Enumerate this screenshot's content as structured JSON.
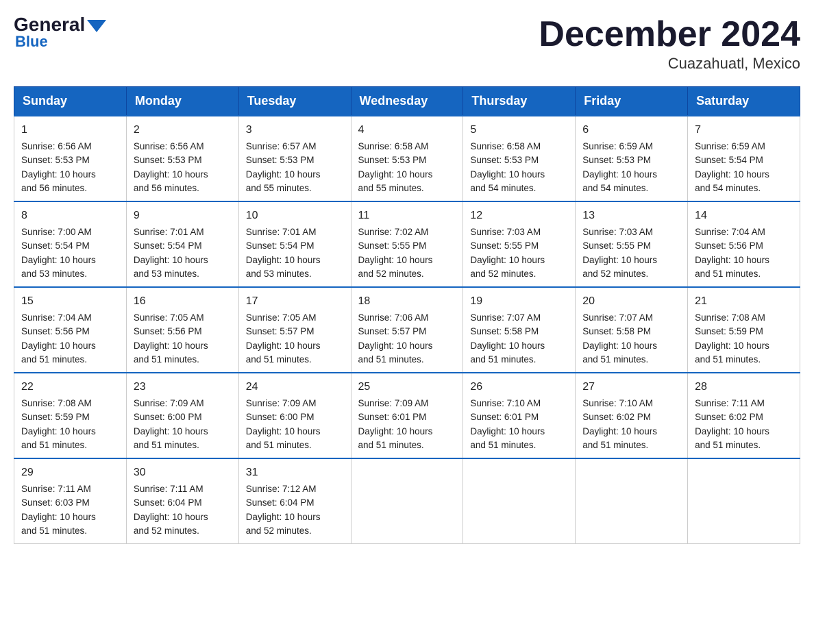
{
  "logo": {
    "general": "General",
    "blue": "Blue"
  },
  "title": "December 2024",
  "location": "Cuazahuatl, Mexico",
  "days_header": [
    "Sunday",
    "Monday",
    "Tuesday",
    "Wednesday",
    "Thursday",
    "Friday",
    "Saturday"
  ],
  "weeks": [
    [
      {
        "day": "1",
        "info": "Sunrise: 6:56 AM\nSunset: 5:53 PM\nDaylight: 10 hours\nand 56 minutes."
      },
      {
        "day": "2",
        "info": "Sunrise: 6:56 AM\nSunset: 5:53 PM\nDaylight: 10 hours\nand 56 minutes."
      },
      {
        "day": "3",
        "info": "Sunrise: 6:57 AM\nSunset: 5:53 PM\nDaylight: 10 hours\nand 55 minutes."
      },
      {
        "day": "4",
        "info": "Sunrise: 6:58 AM\nSunset: 5:53 PM\nDaylight: 10 hours\nand 55 minutes."
      },
      {
        "day": "5",
        "info": "Sunrise: 6:58 AM\nSunset: 5:53 PM\nDaylight: 10 hours\nand 54 minutes."
      },
      {
        "day": "6",
        "info": "Sunrise: 6:59 AM\nSunset: 5:53 PM\nDaylight: 10 hours\nand 54 minutes."
      },
      {
        "day": "7",
        "info": "Sunrise: 6:59 AM\nSunset: 5:54 PM\nDaylight: 10 hours\nand 54 minutes."
      }
    ],
    [
      {
        "day": "8",
        "info": "Sunrise: 7:00 AM\nSunset: 5:54 PM\nDaylight: 10 hours\nand 53 minutes."
      },
      {
        "day": "9",
        "info": "Sunrise: 7:01 AM\nSunset: 5:54 PM\nDaylight: 10 hours\nand 53 minutes."
      },
      {
        "day": "10",
        "info": "Sunrise: 7:01 AM\nSunset: 5:54 PM\nDaylight: 10 hours\nand 53 minutes."
      },
      {
        "day": "11",
        "info": "Sunrise: 7:02 AM\nSunset: 5:55 PM\nDaylight: 10 hours\nand 52 minutes."
      },
      {
        "day": "12",
        "info": "Sunrise: 7:03 AM\nSunset: 5:55 PM\nDaylight: 10 hours\nand 52 minutes."
      },
      {
        "day": "13",
        "info": "Sunrise: 7:03 AM\nSunset: 5:55 PM\nDaylight: 10 hours\nand 52 minutes."
      },
      {
        "day": "14",
        "info": "Sunrise: 7:04 AM\nSunset: 5:56 PM\nDaylight: 10 hours\nand 51 minutes."
      }
    ],
    [
      {
        "day": "15",
        "info": "Sunrise: 7:04 AM\nSunset: 5:56 PM\nDaylight: 10 hours\nand 51 minutes."
      },
      {
        "day": "16",
        "info": "Sunrise: 7:05 AM\nSunset: 5:56 PM\nDaylight: 10 hours\nand 51 minutes."
      },
      {
        "day": "17",
        "info": "Sunrise: 7:05 AM\nSunset: 5:57 PM\nDaylight: 10 hours\nand 51 minutes."
      },
      {
        "day": "18",
        "info": "Sunrise: 7:06 AM\nSunset: 5:57 PM\nDaylight: 10 hours\nand 51 minutes."
      },
      {
        "day": "19",
        "info": "Sunrise: 7:07 AM\nSunset: 5:58 PM\nDaylight: 10 hours\nand 51 minutes."
      },
      {
        "day": "20",
        "info": "Sunrise: 7:07 AM\nSunset: 5:58 PM\nDaylight: 10 hours\nand 51 minutes."
      },
      {
        "day": "21",
        "info": "Sunrise: 7:08 AM\nSunset: 5:59 PM\nDaylight: 10 hours\nand 51 minutes."
      }
    ],
    [
      {
        "day": "22",
        "info": "Sunrise: 7:08 AM\nSunset: 5:59 PM\nDaylight: 10 hours\nand 51 minutes."
      },
      {
        "day": "23",
        "info": "Sunrise: 7:09 AM\nSunset: 6:00 PM\nDaylight: 10 hours\nand 51 minutes."
      },
      {
        "day": "24",
        "info": "Sunrise: 7:09 AM\nSunset: 6:00 PM\nDaylight: 10 hours\nand 51 minutes."
      },
      {
        "day": "25",
        "info": "Sunrise: 7:09 AM\nSunset: 6:01 PM\nDaylight: 10 hours\nand 51 minutes."
      },
      {
        "day": "26",
        "info": "Sunrise: 7:10 AM\nSunset: 6:01 PM\nDaylight: 10 hours\nand 51 minutes."
      },
      {
        "day": "27",
        "info": "Sunrise: 7:10 AM\nSunset: 6:02 PM\nDaylight: 10 hours\nand 51 minutes."
      },
      {
        "day": "28",
        "info": "Sunrise: 7:11 AM\nSunset: 6:02 PM\nDaylight: 10 hours\nand 51 minutes."
      }
    ],
    [
      {
        "day": "29",
        "info": "Sunrise: 7:11 AM\nSunset: 6:03 PM\nDaylight: 10 hours\nand 51 minutes."
      },
      {
        "day": "30",
        "info": "Sunrise: 7:11 AM\nSunset: 6:04 PM\nDaylight: 10 hours\nand 52 minutes."
      },
      {
        "day": "31",
        "info": "Sunrise: 7:12 AM\nSunset: 6:04 PM\nDaylight: 10 hours\nand 52 minutes."
      },
      null,
      null,
      null,
      null
    ]
  ]
}
